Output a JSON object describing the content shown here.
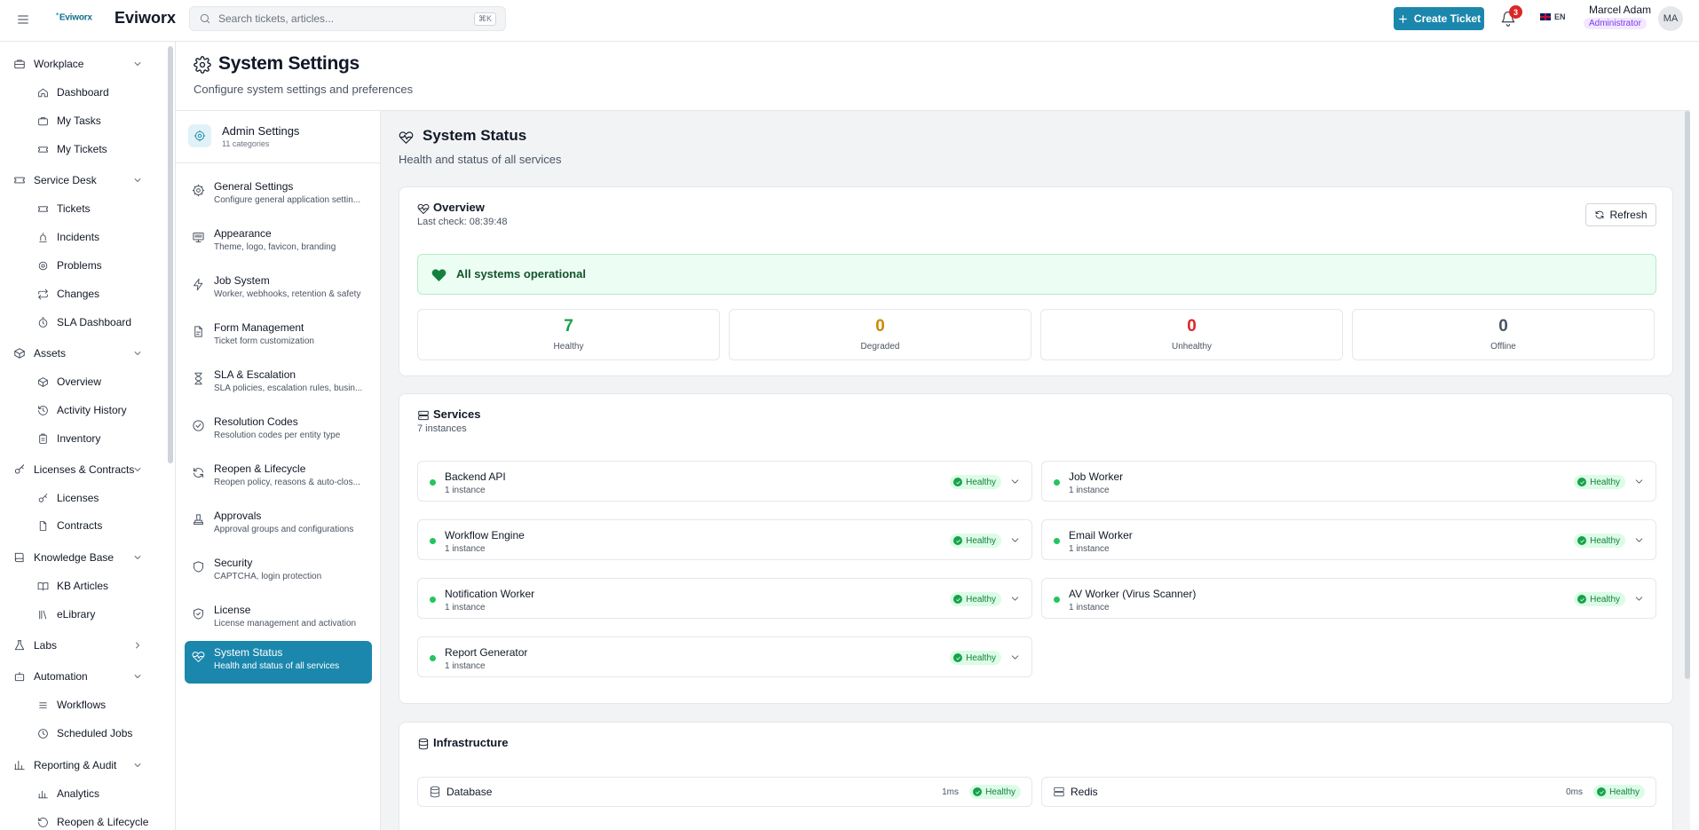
{
  "app": {
    "logo_small": "Eviworx",
    "brand": "Eviworx"
  },
  "header": {
    "search_placeholder": "Search tickets, articles...",
    "search_shortcut": "⌘K",
    "create_ticket": "Create Ticket",
    "notification_count": "3",
    "language": "EN",
    "user_name": "Marcel Adam",
    "user_role": "Administrator",
    "avatar": "MA"
  },
  "nav": {
    "groups": [
      {
        "label": "Workplace",
        "icon": "briefcase-icon",
        "items": [
          "Dashboard",
          "My Tasks",
          "My Tickets"
        ]
      },
      {
        "label": "Service Desk",
        "icon": "ticket-icon",
        "items": [
          "Tickets",
          "Incidents",
          "Problems",
          "Changes",
          "SLA Dashboard"
        ]
      },
      {
        "label": "Assets",
        "icon": "box-icon",
        "items": [
          "Overview",
          "Activity History",
          "Inventory"
        ]
      },
      {
        "label": "Licenses & Contracts",
        "icon": "key-icon",
        "items": [
          "Licenses",
          "Contracts"
        ]
      },
      {
        "label": "Knowledge Base",
        "icon": "book-icon",
        "items": [
          "KB Articles",
          "eLibrary"
        ]
      },
      {
        "label": "Labs",
        "icon": "flask-icon",
        "items": []
      },
      {
        "label": "Automation",
        "icon": "bot-icon",
        "items": [
          "Workflows",
          "Scheduled Jobs"
        ]
      },
      {
        "label": "Reporting & Audit",
        "icon": "chart-icon",
        "items": [
          "Analytics",
          "Reopen & Lifecycle"
        ]
      }
    ]
  },
  "page": {
    "title": "System Settings",
    "subtitle": "Configure system settings and preferences"
  },
  "settings_sidebar": {
    "title": "Admin Settings",
    "subtitle": "11 categories",
    "items": [
      {
        "title": "General Settings",
        "desc": "Configure general application settin...",
        "icon": "gear-icon"
      },
      {
        "title": "Appearance",
        "desc": "Theme, logo, favicon, branding",
        "icon": "monitor-icon"
      },
      {
        "title": "Job System",
        "desc": "Worker, webhooks, retention & safety",
        "icon": "bolt-icon"
      },
      {
        "title": "Form Management",
        "desc": "Ticket form customization",
        "icon": "file-icon"
      },
      {
        "title": "SLA & Escalation",
        "desc": "SLA policies, escalation rules, busin...",
        "icon": "hourglass-icon"
      },
      {
        "title": "Resolution Codes",
        "desc": "Resolution codes per entity type",
        "icon": "check-circle-icon"
      },
      {
        "title": "Reopen & Lifecycle",
        "desc": "Reopen policy, reasons & auto-clos...",
        "icon": "refresh-icon"
      },
      {
        "title": "Approvals",
        "desc": "Approval groups and configurations",
        "icon": "stamp-icon"
      },
      {
        "title": "Security",
        "desc": "CAPTCHA, login protection",
        "icon": "shield-icon"
      },
      {
        "title": "License",
        "desc": "License management and activation",
        "icon": "shield-check-icon"
      },
      {
        "title": "System Status",
        "desc": "Health and status of all services",
        "icon": "heart-pulse-icon"
      }
    ]
  },
  "status": {
    "title": "System Status",
    "subtitle": "Health and status of all services",
    "overview": {
      "title": "Overview",
      "last_check": "Last check: 08:39:48",
      "refresh": "Refresh",
      "banner": "All systems operational",
      "stats": [
        {
          "value": "7",
          "label": "Healthy",
          "color": "#16a34a"
        },
        {
          "value": "0",
          "label": "Degraded",
          "color": "#ca8a04"
        },
        {
          "value": "0",
          "label": "Unhealthy",
          "color": "#dc2626"
        },
        {
          "value": "0",
          "label": "Offline",
          "color": "#4b5563"
        }
      ]
    },
    "services": {
      "title": "Services",
      "count": "7 instances",
      "items": [
        {
          "name": "Backend API",
          "instances": "1 instance",
          "status": "Healthy"
        },
        {
          "name": "Job Worker",
          "instances": "1 instance",
          "status": "Healthy"
        },
        {
          "name": "Workflow Engine",
          "instances": "1 instance",
          "status": "Healthy"
        },
        {
          "name": "Email Worker",
          "instances": "1 instance",
          "status": "Healthy"
        },
        {
          "name": "Notification Worker",
          "instances": "1 instance",
          "status": "Healthy"
        },
        {
          "name": "AV Worker (Virus Scanner)",
          "instances": "1 instance",
          "status": "Healthy"
        },
        {
          "name": "Report Generator",
          "instances": "1 instance",
          "status": "Healthy"
        }
      ]
    },
    "infrastructure": {
      "title": "Infrastructure",
      "items": [
        {
          "name": "Database",
          "latency": "1ms",
          "status": "Healthy"
        },
        {
          "name": "Redis",
          "latency": "0ms",
          "status": "Healthy"
        }
      ]
    }
  }
}
